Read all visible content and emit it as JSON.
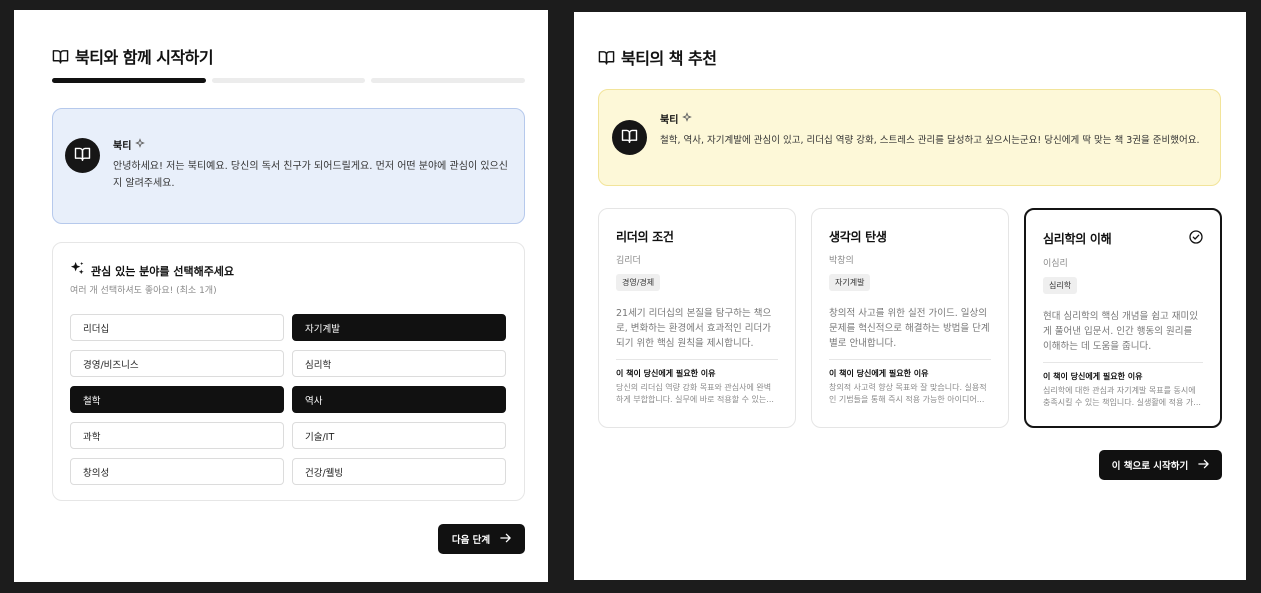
{
  "onboarding": {
    "title": "북티와 함께 시작하기",
    "progress_filled": 1,
    "progress_total": 3,
    "bot": {
      "name": "북티",
      "message": "안녕하세요! 저는 북티예요. 당신의 독서 친구가 되어드릴게요. 먼저 어떤 분야에 관심이 있으신지 알려주세요."
    },
    "interest": {
      "title": "관심 있는 분야를 선택해주세요",
      "subtitle": "여러 개 선택하셔도 좋아요! (최소 1개)",
      "options": [
        {
          "label": "리더십",
          "selected": false
        },
        {
          "label": "자기계발",
          "selected": true
        },
        {
          "label": "경영/비즈니스",
          "selected": false
        },
        {
          "label": "심리학",
          "selected": false
        },
        {
          "label": "철학",
          "selected": true
        },
        {
          "label": "역사",
          "selected": true
        },
        {
          "label": "과학",
          "selected": false
        },
        {
          "label": "기술/IT",
          "selected": false
        },
        {
          "label": "창의성",
          "selected": false
        },
        {
          "label": "건강/웰빙",
          "selected": false
        }
      ]
    },
    "next_button": "다음 단계"
  },
  "recommendation": {
    "title": "북티의 책 추천",
    "bot": {
      "name": "북티",
      "message": "철학, 역사, 자기계발에 관심이 있고, 리더십 역량 강화, 스트레스 관리를 달성하고 싶으시는군요! 당신에게 딱 맞는 책 3권을 준비했어요."
    },
    "books": [
      {
        "title": "리더의 조건",
        "author": "김리더",
        "tag": "경영/경제",
        "description": "21세기 리더십의 본질을 탐구하는 책으로, 변화하는 환경에서 효과적인 리더가 되기 위한 핵심 원칙을 제시합니다.",
        "why_label": "이 책이 당신에게 필요한 이유",
        "why": "당신의 리더십 역량 강화 목표와 관심사에 완벽하게 부합합니다. 실무에 바로 적용할 수 있는...",
        "selected": false
      },
      {
        "title": "생각의 탄생",
        "author": "박창의",
        "tag": "자기계발",
        "description": "창의적 사고를 위한 실전 가이드. 일상의 문제를 혁신적으로 해결하는 방법을 단계별로 안내합니다.",
        "why_label": "이 책이 당신에게 필요한 이유",
        "why": "창의적 사고력 향상 목표와 잘 맞습니다. 실용적인 기법들을 통해 즉시 적용 가능한 아이디어...",
        "selected": false
      },
      {
        "title": "심리학의 이해",
        "author": "이심리",
        "tag": "심리학",
        "description": "현대 심리학의 핵심 개념을 쉽고 재미있게 풀어낸 입문서. 인간 행동의 원리를 이해하는 데 도움을 줍니다.",
        "why_label": "이 책이 당신에게 필요한 이유",
        "why": "심리학에 대한 관심과 자기계발 목표를 동시에 충족시킬 수 있는 책입니다. 실생활에 적용 가...",
        "selected": true
      }
    ],
    "start_button": "이 책으로 시작하기"
  },
  "icons": {
    "title": "open-book-icon",
    "avatar": "open-book-icon",
    "bot_badge": "sparkle-icon",
    "interest": "sparkles-icon",
    "button": "arrow-right-icon",
    "selected_book": "check-circle-icon"
  }
}
